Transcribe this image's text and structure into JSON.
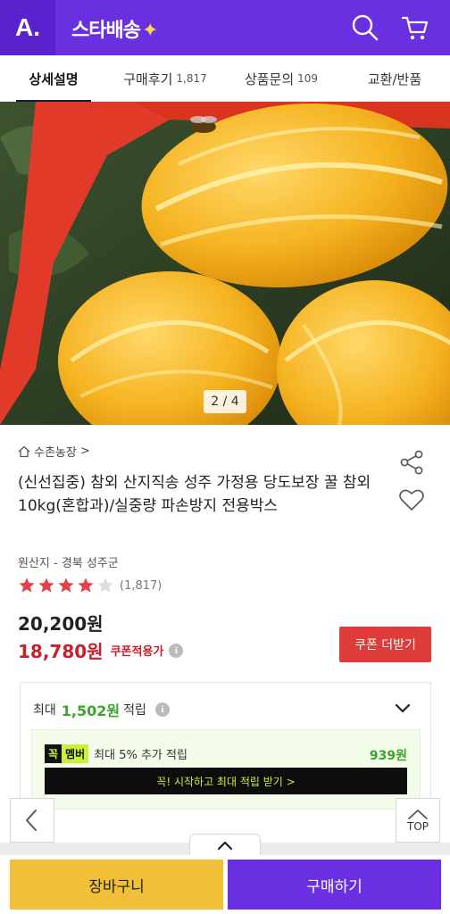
{
  "header": {
    "logo": "A.",
    "brand": "스타배송",
    "brand_spark": "✦",
    "icons": [
      "search-icon",
      "cart-icon"
    ],
    "colors": {
      "brand_purple": "#6a2fe0",
      "logo_bg": "#5a22cf"
    }
  },
  "tabs": [
    {
      "label": "상세설명",
      "count": "",
      "active": true
    },
    {
      "label": "구매후기",
      "count": "1,817",
      "active": false
    },
    {
      "label": "상품문의",
      "count": "109",
      "active": false
    },
    {
      "label": "교환/반품",
      "count": "",
      "active": false
    }
  ],
  "gallery": {
    "current": "2",
    "total": "4",
    "pager_text": "2 / 4"
  },
  "product": {
    "store": "수촌농장",
    "store_chevron": ">",
    "title": "(신선집중) 참외 산지직송 성주 가정용 당도보장 꿀 참외 10kg(혼합과)/실중량 파손방지 전용박스",
    "origin": "원산지 - 경북 성주군",
    "rating": 4,
    "rating_max": 5,
    "review_count": "(1,817)",
    "price": "20,200원",
    "coupon_price": "18,780원",
    "coupon_label": "쿠폰적용가",
    "info_glyph": "i",
    "coupon_button": "쿠폰 더받기"
  },
  "reward": {
    "prefix": "최대",
    "amount": "1,502원",
    "suffix": "적립",
    "member_badge_1": "꼭",
    "member_badge_2": "멤버",
    "member_text": "최대 5% 추가 적립",
    "member_amount": "939원",
    "member_cta": "꼭! 시작하고 최대 적립 받기  >"
  },
  "float": {
    "top_label": "TOP"
  },
  "bottom": {
    "cart": "장바구니",
    "buy": "구매하기"
  },
  "colors": {
    "accent_red": "#de3b3b",
    "green": "#3aa52a",
    "cart_yellow": "#f2c038",
    "star_red": "#e0434a"
  }
}
